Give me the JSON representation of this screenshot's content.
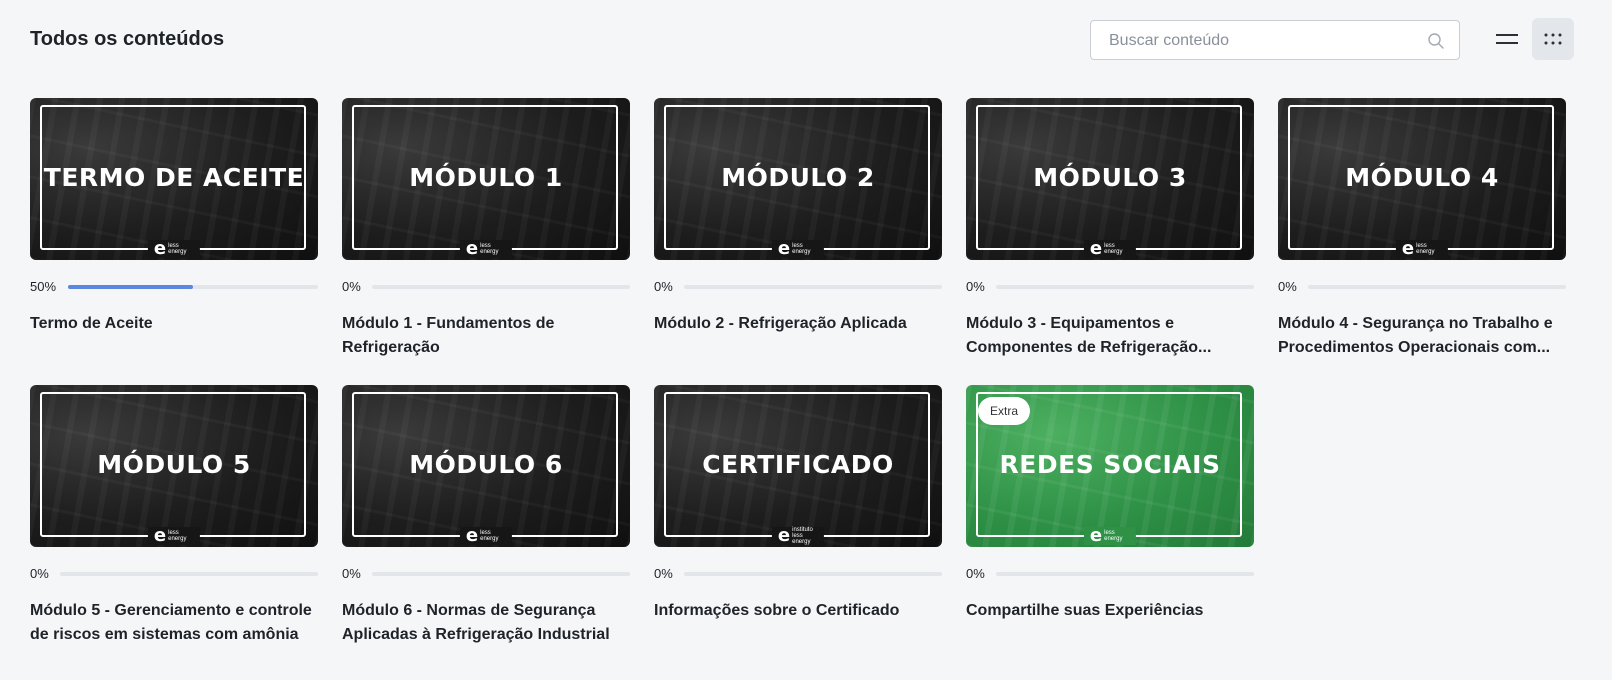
{
  "header": {
    "title": "Todos os conteúdos",
    "search_placeholder": "Buscar conteúdo"
  },
  "icons": {
    "search": "search-icon",
    "list_view": "list-view-icon",
    "grid_view": "grid-view-icon"
  },
  "colors": {
    "progress_fill": "#5b87e0",
    "dark_thumb": "#1d1d1d",
    "green_thumb": "#2e9146"
  },
  "cards": [
    {
      "thumb_title": "TERMO DE ACEITE",
      "logo": "less energy",
      "percent_label": "50%",
      "progress": 0.5,
      "title": "Termo de Aceite",
      "theme": "dark"
    },
    {
      "thumb_title": "MÓDULO 1",
      "logo": "less energy",
      "percent_label": "0%",
      "progress": 0,
      "title": "Módulo 1 - Fundamentos de Refrigeração",
      "theme": "dark"
    },
    {
      "thumb_title": "MÓDULO 2",
      "logo": "less energy",
      "percent_label": "0%",
      "progress": 0,
      "title": "Módulo 2 - Refrigeração Aplicada",
      "theme": "dark"
    },
    {
      "thumb_title": "MÓDULO 3",
      "logo": "less energy",
      "percent_label": "0%",
      "progress": 0,
      "title": "Módulo 3 - Equipamentos e Componentes de Refrigeração...",
      "theme": "dark"
    },
    {
      "thumb_title": "MÓDULO 4",
      "logo": "less energy",
      "percent_label": "0%",
      "progress": 0,
      "title": "Módulo 4 - Segurança no Trabalho e Procedimentos Operacionais com...",
      "theme": "dark"
    },
    {
      "thumb_title": "MÓDULO 5",
      "logo": "less energy",
      "percent_label": "0%",
      "progress": 0,
      "title": "Módulo 5 - Gerenciamento e controle de riscos em sistemas com amônia",
      "theme": "dark"
    },
    {
      "thumb_title": "MÓDULO 6",
      "logo": "less energy",
      "percent_label": "0%",
      "progress": 0,
      "title": "Módulo 6 - Normas de Segurança Aplicadas à Refrigeração Industrial",
      "theme": "dark"
    },
    {
      "thumb_title": "CERTIFICADO",
      "logo": "instituto less energy",
      "percent_label": "0%",
      "progress": 0,
      "title": "Informações sobre o Certificado",
      "theme": "dark"
    },
    {
      "thumb_title": "REDES SOCIAIS",
      "logo": "less energy",
      "percent_label": "0%",
      "progress": 0,
      "title": "Compartilhe suas Experiências",
      "theme": "green",
      "badge": "Extra"
    }
  ]
}
